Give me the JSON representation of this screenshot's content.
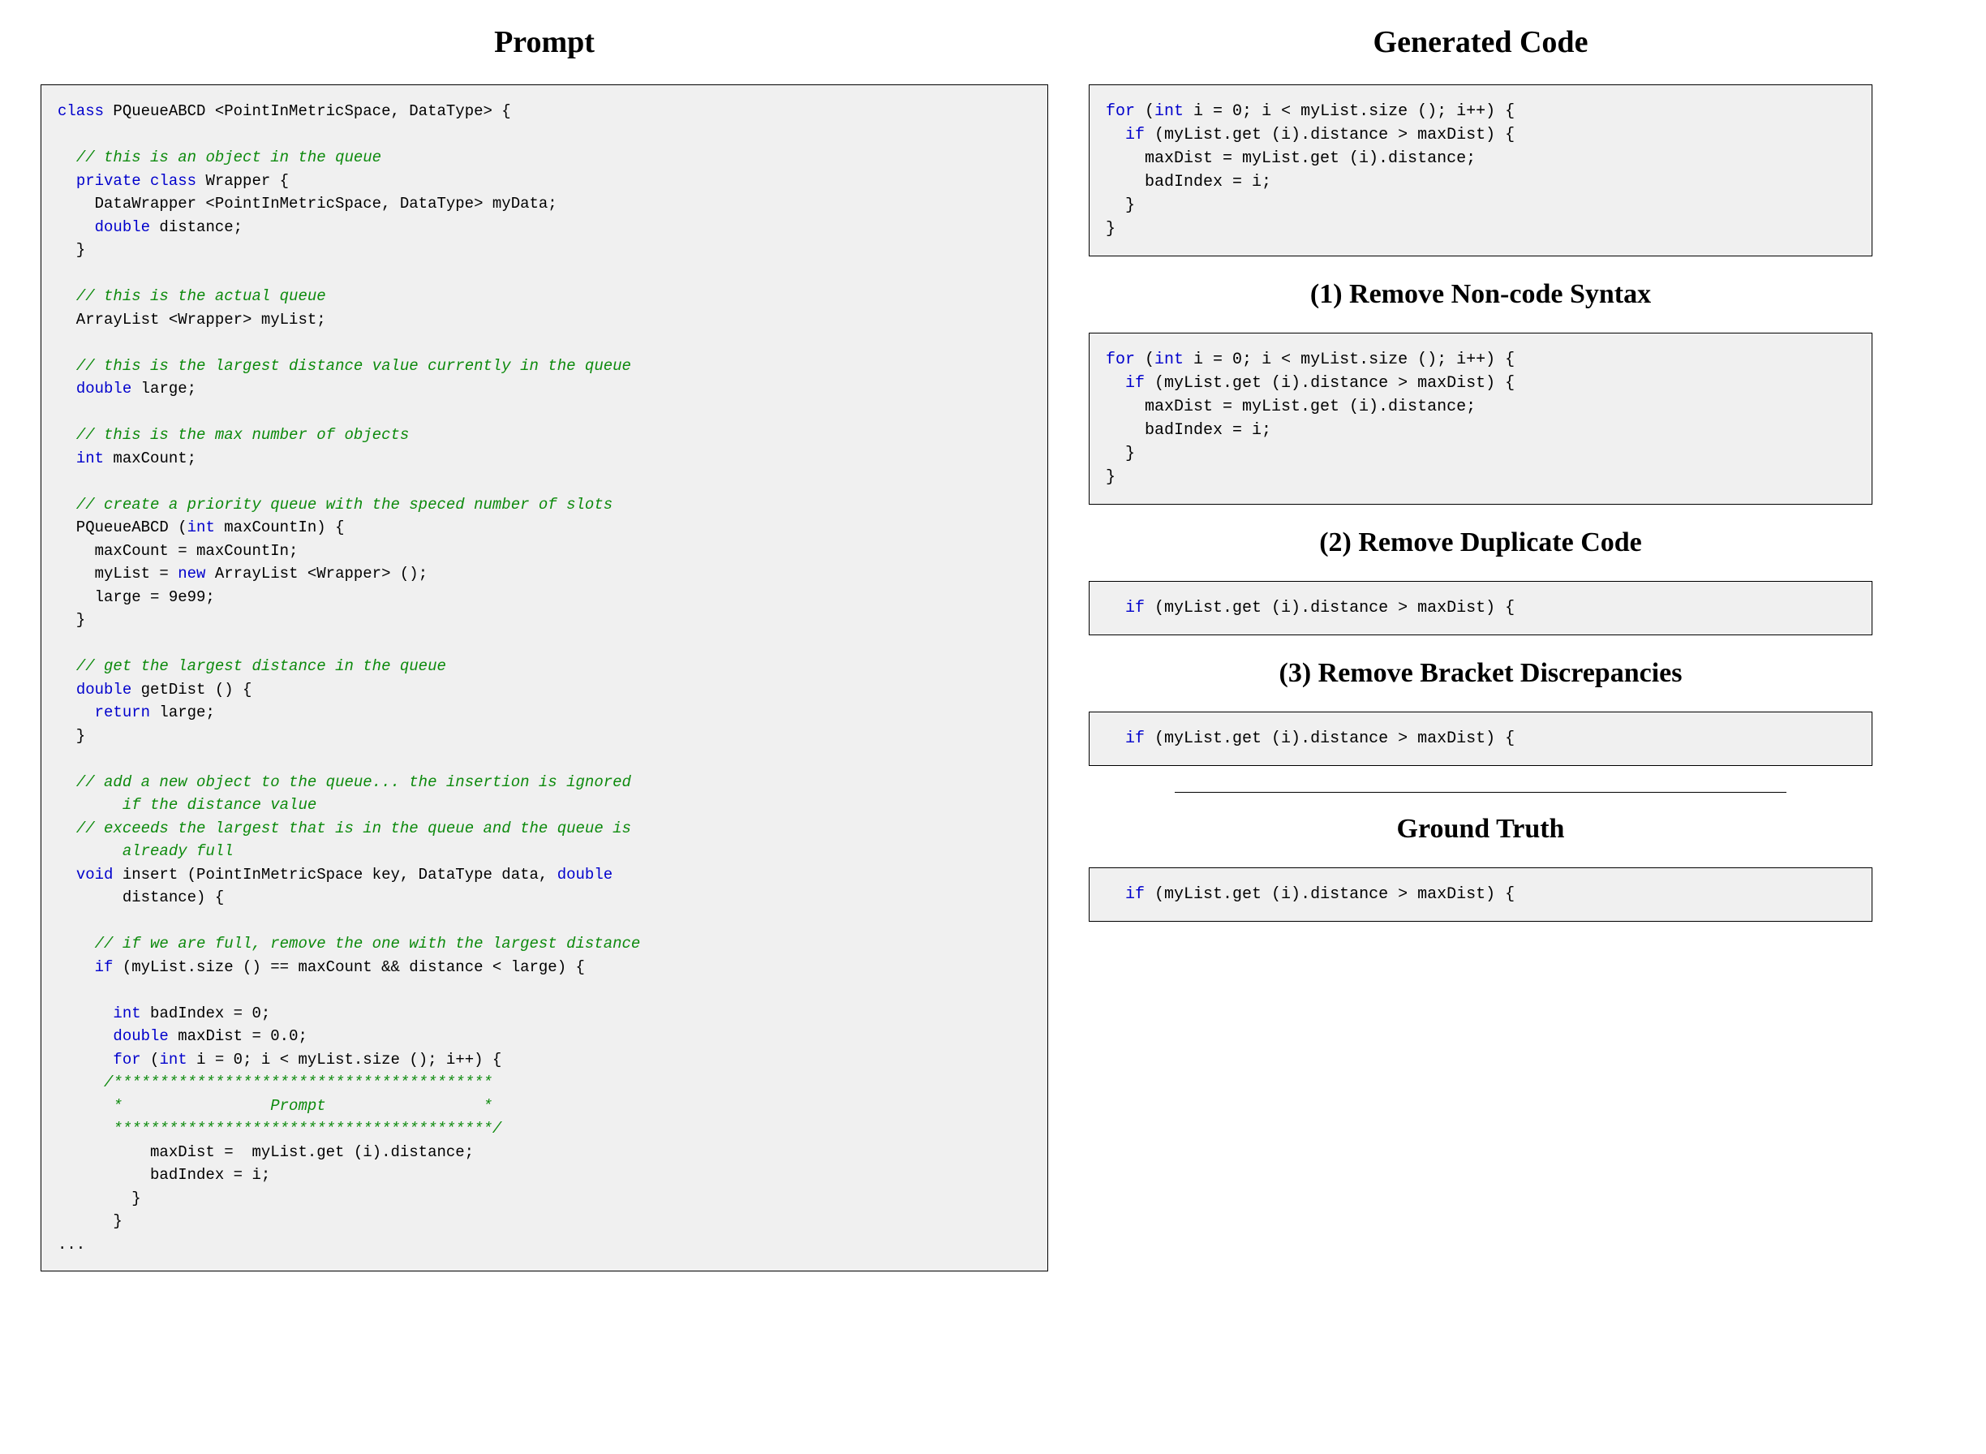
{
  "left": {
    "title": "Prompt"
  },
  "right": {
    "title": "Generated Code",
    "step1_title": "(1) Remove Non-code Syntax",
    "step2_title": "(2) Remove Duplicate Code",
    "step3_title": "(3) Remove Bracket Discrepancies",
    "gt_title": "Ground Truth"
  },
  "colors": {
    "keyword": "#0000cc",
    "comment": "#4caf50",
    "background_box": "#f0f0f0"
  },
  "code": {
    "prompt": [
      {
        "cls": "kw",
        "t": "class"
      },
      {
        "cls": "plain",
        "t": " PQueueABCD <PointInMetricSpace, DataType> {\n"
      },
      {
        "cls": "plain",
        "t": "\n"
      },
      {
        "cls": "plain",
        "t": "  "
      },
      {
        "cls": "cm",
        "t": "// this is an object in the queue"
      },
      {
        "cls": "plain",
        "t": "\n"
      },
      {
        "cls": "plain",
        "t": "  "
      },
      {
        "cls": "kw",
        "t": "private class"
      },
      {
        "cls": "plain",
        "t": " Wrapper {\n"
      },
      {
        "cls": "plain",
        "t": "    DataWrapper <PointInMetricSpace, DataType> myData;\n"
      },
      {
        "cls": "plain",
        "t": "    "
      },
      {
        "cls": "kw",
        "t": "double"
      },
      {
        "cls": "plain",
        "t": " distance;\n"
      },
      {
        "cls": "plain",
        "t": "  }\n"
      },
      {
        "cls": "plain",
        "t": "\n"
      },
      {
        "cls": "plain",
        "t": "  "
      },
      {
        "cls": "cm",
        "t": "// this is the actual queue"
      },
      {
        "cls": "plain",
        "t": "\n"
      },
      {
        "cls": "plain",
        "t": "  ArrayList <Wrapper> myList;\n"
      },
      {
        "cls": "plain",
        "t": "\n"
      },
      {
        "cls": "plain",
        "t": "  "
      },
      {
        "cls": "cm",
        "t": "// this is the largest distance value currently in the queue"
      },
      {
        "cls": "plain",
        "t": "\n"
      },
      {
        "cls": "plain",
        "t": "  "
      },
      {
        "cls": "kw",
        "t": "double"
      },
      {
        "cls": "plain",
        "t": " large;\n"
      },
      {
        "cls": "plain",
        "t": "\n"
      },
      {
        "cls": "plain",
        "t": "  "
      },
      {
        "cls": "cm",
        "t": "// this is the max number of objects"
      },
      {
        "cls": "plain",
        "t": "\n"
      },
      {
        "cls": "plain",
        "t": "  "
      },
      {
        "cls": "kw",
        "t": "int"
      },
      {
        "cls": "plain",
        "t": " maxCount;\n"
      },
      {
        "cls": "plain",
        "t": "\n"
      },
      {
        "cls": "plain",
        "t": "  "
      },
      {
        "cls": "cm",
        "t": "// create a priority queue with the speced number of slots"
      },
      {
        "cls": "plain",
        "t": "\n"
      },
      {
        "cls": "plain",
        "t": "  PQueueABCD ("
      },
      {
        "cls": "kw",
        "t": "int"
      },
      {
        "cls": "plain",
        "t": " maxCountIn) {\n"
      },
      {
        "cls": "plain",
        "t": "    maxCount = maxCountIn;\n"
      },
      {
        "cls": "plain",
        "t": "    myList = "
      },
      {
        "cls": "kw",
        "t": "new"
      },
      {
        "cls": "plain",
        "t": " ArrayList <Wrapper> ();\n"
      },
      {
        "cls": "plain",
        "t": "    large = 9e99;\n"
      },
      {
        "cls": "plain",
        "t": "  }\n"
      },
      {
        "cls": "plain",
        "t": "\n"
      },
      {
        "cls": "plain",
        "t": "  "
      },
      {
        "cls": "cm",
        "t": "// get the largest distance in the queue"
      },
      {
        "cls": "plain",
        "t": "\n"
      },
      {
        "cls": "plain",
        "t": "  "
      },
      {
        "cls": "kw",
        "t": "double"
      },
      {
        "cls": "plain",
        "t": " getDist () {\n"
      },
      {
        "cls": "plain",
        "t": "    "
      },
      {
        "cls": "kw",
        "t": "return"
      },
      {
        "cls": "plain",
        "t": " large;\n"
      },
      {
        "cls": "plain",
        "t": "  }\n"
      },
      {
        "cls": "plain",
        "t": "\n"
      },
      {
        "cls": "plain",
        "t": "  "
      },
      {
        "cls": "cm",
        "t": "// add a new object to the queue... the insertion is ignored\n       if the distance value"
      },
      {
        "cls": "plain",
        "t": "\n"
      },
      {
        "cls": "plain",
        "t": "  "
      },
      {
        "cls": "cm",
        "t": "// exceeds the largest that is in the queue and the queue is\n       already full"
      },
      {
        "cls": "plain",
        "t": "\n"
      },
      {
        "cls": "plain",
        "t": "  "
      },
      {
        "cls": "kw",
        "t": "void"
      },
      {
        "cls": "plain",
        "t": " insert (PointInMetricSpace key, DataType data, "
      },
      {
        "cls": "kw",
        "t": "double"
      },
      {
        "cls": "plain",
        "t": "\n       distance) {\n"
      },
      {
        "cls": "plain",
        "t": "\n"
      },
      {
        "cls": "plain",
        "t": "    "
      },
      {
        "cls": "cm",
        "t": "// if we are full, remove the one with the largest distance"
      },
      {
        "cls": "plain",
        "t": "\n"
      },
      {
        "cls": "plain",
        "t": "    "
      },
      {
        "cls": "kw",
        "t": "if"
      },
      {
        "cls": "plain",
        "t": " (myList.size () == maxCount && distance < large) {\n"
      },
      {
        "cls": "plain",
        "t": "\n"
      },
      {
        "cls": "plain",
        "t": "      "
      },
      {
        "cls": "kw",
        "t": "int"
      },
      {
        "cls": "plain",
        "t": " badIndex = 0;\n"
      },
      {
        "cls": "plain",
        "t": "      "
      },
      {
        "cls": "kw",
        "t": "double"
      },
      {
        "cls": "plain",
        "t": " maxDist = 0.0;\n"
      },
      {
        "cls": "plain",
        "t": "      "
      },
      {
        "cls": "kw",
        "t": "for"
      },
      {
        "cls": "plain",
        "t": " ("
      },
      {
        "cls": "kw",
        "t": "int"
      },
      {
        "cls": "plain",
        "t": " i = 0; i < myList.size (); i++) {\n"
      },
      {
        "cls": "plain",
        "t": "     "
      },
      {
        "cls": "cm",
        "t": "/*****************************************\n      *                Prompt                 *\n      *****************************************/"
      },
      {
        "cls": "plain",
        "t": "\n"
      },
      {
        "cls": "plain",
        "t": "          maxDist =  myList.get (i).distance;\n"
      },
      {
        "cls": "plain",
        "t": "          badIndex = i;\n"
      },
      {
        "cls": "plain",
        "t": "        }\n"
      },
      {
        "cls": "plain",
        "t": "      }\n"
      },
      {
        "cls": "plain",
        "t": "..."
      }
    ],
    "generated": [
      {
        "cls": "kw",
        "t": "for"
      },
      {
        "cls": "plain",
        "t": " ("
      },
      {
        "cls": "kw",
        "t": "int"
      },
      {
        "cls": "plain",
        "t": " i = 0; i < myList.size (); i++) {\n"
      },
      {
        "cls": "plain",
        "t": "  "
      },
      {
        "cls": "kw",
        "t": "if"
      },
      {
        "cls": "plain",
        "t": " (myList.get (i).distance > maxDist) {\n"
      },
      {
        "cls": "plain",
        "t": "    maxDist = myList.get (i).distance;\n"
      },
      {
        "cls": "plain",
        "t": "    badIndex = i;\n"
      },
      {
        "cls": "plain",
        "t": "  }\n"
      },
      {
        "cls": "plain",
        "t": "}"
      }
    ],
    "step1": [
      {
        "cls": "kw",
        "t": "for"
      },
      {
        "cls": "plain",
        "t": " ("
      },
      {
        "cls": "kw",
        "t": "int"
      },
      {
        "cls": "plain",
        "t": " i = 0; i < myList.size (); i++) {\n"
      },
      {
        "cls": "plain",
        "t": "  "
      },
      {
        "cls": "kw",
        "t": "if"
      },
      {
        "cls": "plain",
        "t": " (myList.get (i).distance > maxDist) {\n"
      },
      {
        "cls": "plain",
        "t": "    maxDist = myList.get (i).distance;\n"
      },
      {
        "cls": "plain",
        "t": "    badIndex = i;\n"
      },
      {
        "cls": "plain",
        "t": "  }\n"
      },
      {
        "cls": "plain",
        "t": "}"
      }
    ],
    "step2": [
      {
        "cls": "plain",
        "t": "  "
      },
      {
        "cls": "kw",
        "t": "if"
      },
      {
        "cls": "plain",
        "t": " (myList.get (i).distance > maxDist) {"
      }
    ],
    "step3": [
      {
        "cls": "plain",
        "t": "  "
      },
      {
        "cls": "kw",
        "t": "if"
      },
      {
        "cls": "plain",
        "t": " (myList.get (i).distance > maxDist) {"
      }
    ],
    "gt": [
      {
        "cls": "plain",
        "t": "  "
      },
      {
        "cls": "kw",
        "t": "if"
      },
      {
        "cls": "plain",
        "t": " (myList.get (i).distance > maxDist) {"
      }
    ]
  }
}
